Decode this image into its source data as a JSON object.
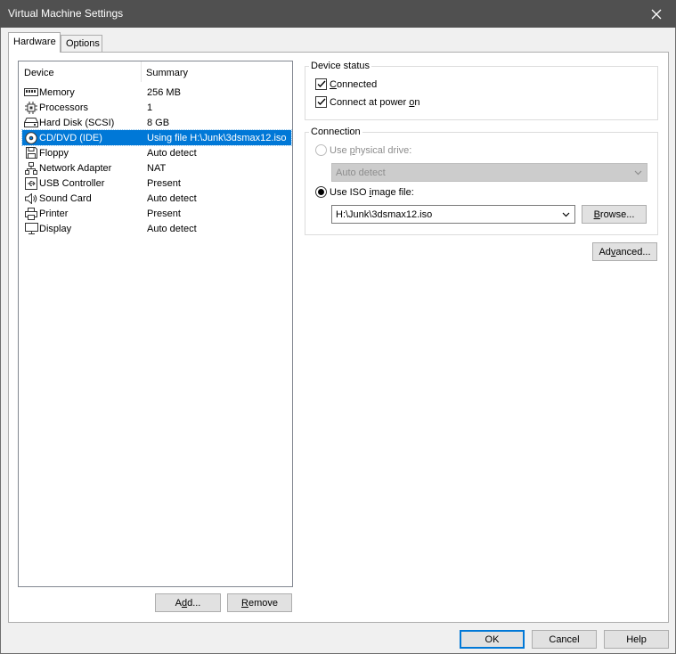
{
  "window": {
    "title": "Virtual Machine Settings"
  },
  "tabs": [
    {
      "label": "Hardware"
    },
    {
      "label": "Options"
    }
  ],
  "device_list": {
    "columns": [
      "Device",
      "Summary"
    ],
    "rows": [
      {
        "icon": "memory-icon",
        "device": "Memory",
        "summary": "256 MB"
      },
      {
        "icon": "processor-icon",
        "device": "Processors",
        "summary": "1"
      },
      {
        "icon": "hard-disk-icon",
        "device": "Hard Disk (SCSI)",
        "summary": "8 GB"
      },
      {
        "icon": "cd-dvd-icon",
        "device": "CD/DVD (IDE)",
        "summary": "Using file H:\\Junk\\3dsmax12.iso"
      },
      {
        "icon": "floppy-icon",
        "device": "Floppy",
        "summary": "Auto detect"
      },
      {
        "icon": "network-adapter-icon",
        "device": "Network Adapter",
        "summary": "NAT"
      },
      {
        "icon": "usb-icon",
        "device": "USB Controller",
        "summary": "Present"
      },
      {
        "icon": "speaker-icon",
        "device": "Sound Card",
        "summary": "Auto detect"
      },
      {
        "icon": "printer-icon",
        "device": "Printer",
        "summary": "Present"
      },
      {
        "icon": "display-icon",
        "device": "Display",
        "summary": "Auto detect"
      }
    ],
    "selected_index": 3
  },
  "list_buttons": {
    "add_pre": "A",
    "add_ul": "d",
    "add_post": "d...",
    "remove_pre": "",
    "remove_ul": "R",
    "remove_post": "emove"
  },
  "device_status": {
    "title": "Device status",
    "connected": {
      "pre": "",
      "ul": "C",
      "post": "onnected",
      "checked": true
    },
    "connect_power_on": {
      "pre": "Connect at power ",
      "ul": "o",
      "post": "n",
      "checked": true
    }
  },
  "connection": {
    "title": "Connection",
    "physical": {
      "pre": "Use ",
      "ul": "p",
      "post": "hysical drive:",
      "selected": false,
      "enabled": false
    },
    "physical_select_value": "Auto detect",
    "iso": {
      "pre": "Use ISO ",
      "ul": "i",
      "post": "mage file:",
      "selected": true
    },
    "iso_path": "H:\\Junk\\3dsmax12.iso",
    "browse": {
      "pre": "",
      "ul": "B",
      "post": "rowse..."
    }
  },
  "advanced": {
    "pre": "Ad",
    "ul": "v",
    "post": "anced..."
  },
  "footer": {
    "ok": "OK",
    "cancel": "Cancel",
    "help": "Help"
  },
  "colors": {
    "selection": "#0078d7",
    "titlebar": "#505050",
    "panel": "#ffffff",
    "window": "#f0f0f0"
  }
}
